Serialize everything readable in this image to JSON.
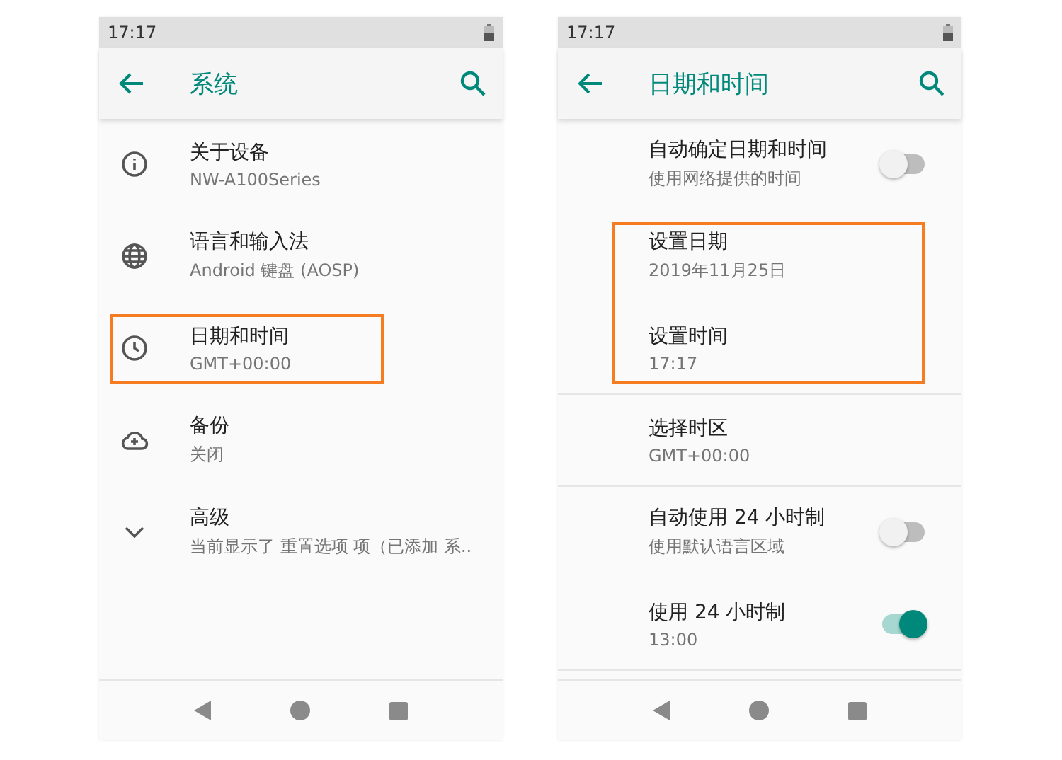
{
  "screens": [
    {
      "kind": "icons",
      "status_bar": {
        "time": "17:17"
      },
      "app_bar": {
        "title": "系统"
      },
      "items": [
        {
          "title": "关于设备",
          "subtitle": "NW-A100Series",
          "highlighted": false,
          "divider_below": false
        },
        {
          "title": "语言和输入法",
          "subtitle": "Android 键盘 (AOSP)",
          "highlighted": false,
          "divider_below": false
        },
        {
          "title": "日期和时间",
          "subtitle": "GMT+00:00",
          "highlighted": true,
          "divider_below": false
        },
        {
          "title": "备份",
          "subtitle": "关闭",
          "highlighted": false,
          "divider_below": false
        },
        {
          "title": "高级",
          "subtitle": "当前显示了 重置选项 项（已添加 系..",
          "highlighted": false,
          "divider_below": false
        }
      ]
    },
    {
      "kind": "plain",
      "status_bar": {
        "time": "17:17"
      },
      "app_bar": {
        "title": "日期和时间"
      },
      "items": [
        {
          "title": "自动确定日期和时间",
          "subtitle": "使用网络提供的时间",
          "switch": {
            "on": false
          },
          "highlighted": false,
          "divider_below": false
        },
        {
          "title": "设置日期",
          "subtitle": "2019年11月25日",
          "highlighted": true,
          "divider_below": false
        },
        {
          "title": "设置时间",
          "subtitle": "17:17",
          "highlighted": true,
          "divider_below": true
        },
        {
          "title": "选择时区",
          "subtitle": "GMT+00:00",
          "highlighted": false,
          "divider_below": true
        },
        {
          "title": "自动使用 24 小时制",
          "subtitle": "使用默认语言区域",
          "switch": {
            "on": false
          },
          "highlighted": false,
          "divider_below": false
        },
        {
          "title": "使用 24 小时制",
          "subtitle": "13:00",
          "switch": {
            "on": true
          },
          "highlighted": false,
          "divider_below": true
        }
      ]
    }
  ]
}
